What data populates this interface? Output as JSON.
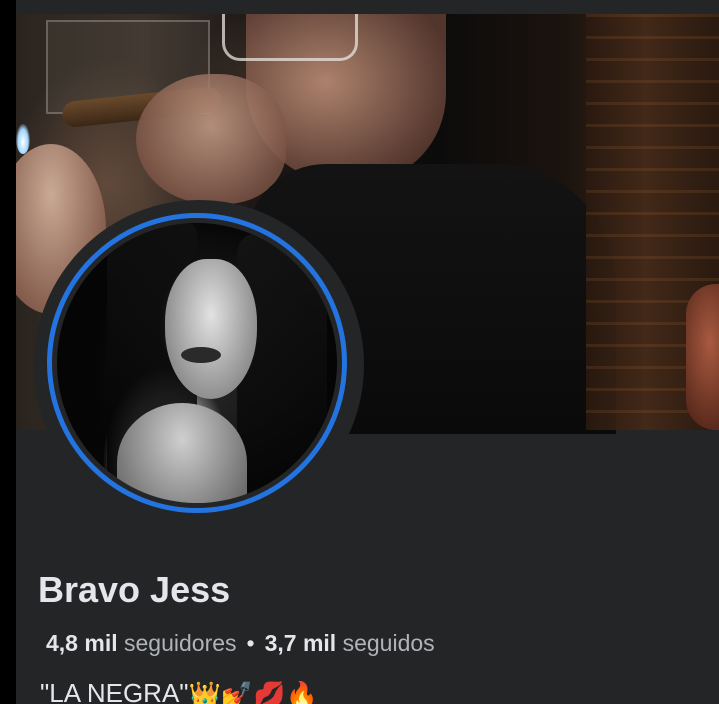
{
  "profile": {
    "name": "Bravo Jess",
    "followers_count": "4,8 mil",
    "followers_label": "seguidores",
    "separator": "•",
    "following_count": "3,7 mil",
    "following_label": "seguidos",
    "bio_text": "\"LA NEGRA\"",
    "bio_emojis": [
      "👑",
      "💅",
      "💋",
      "🔥"
    ]
  },
  "colors": {
    "avatar_ring": "#2374e1",
    "background": "#242526",
    "text_primary": "#e4e6eb",
    "text_secondary": "#b0b3b8"
  }
}
